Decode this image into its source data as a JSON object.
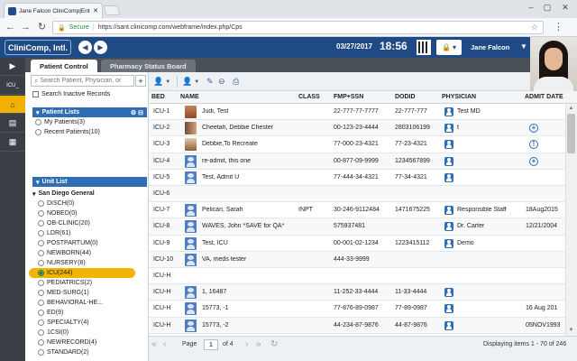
{
  "browser": {
    "tab_title": "Jane Falcon CliniComp|Ent",
    "secure_label": "Secure",
    "url": "https://sant.clinicomp.com/webframe/index.php/Cps"
  },
  "header": {
    "logo": "CliniComp, Intl.",
    "date": "03/27/2017",
    "time": "18:56",
    "user": "Jane Falcon"
  },
  "rail": {
    "icu_label": "ICU_"
  },
  "tabs": [
    "Patient Control",
    "Pharmacy Status Board"
  ],
  "left": {
    "search_placeholder": "Search Patient, Physician, or",
    "search_inactive": "Search Inactive Records",
    "patient_lists_header": "Patient Lists",
    "patient_lists": [
      "My Patients(3)",
      "Recent Patients(10)"
    ],
    "unit_list_header": "Unit List",
    "facility": "San Diego General",
    "units": [
      "DISCH(0)",
      "NOBED(0)",
      "OB-CLINIC(20)",
      "LDR(61)",
      "POSTPARTUM(0)",
      "NEWBORN(44)",
      "NURSERY(8)",
      "ICU(244)",
      "PEDIATRICS(2)",
      "MED-SURG(1)",
      "BEHAVIORAL-HE...",
      "ED(9)",
      "SPECIALTY(4)",
      "1CSI(0)",
      "NEWRECORD(4)",
      "STANDARD(2)"
    ],
    "selected_unit_index": 7
  },
  "grid": {
    "columns": [
      "BED",
      "NAME",
      "CLASS",
      "FMP+SSN",
      "DODID",
      "PHYSICIAN",
      "ADMIT DATE"
    ],
    "rows": [
      {
        "bed": "ICU-1",
        "pic": "photo",
        "name": "Judi, Test",
        "cls": "",
        "fmp": "22-777-77-7777",
        "dodid": "22-777-777",
        "phys_icon": true,
        "physician": "Test MD",
        "admit": "",
        "status": ""
      },
      {
        "bed": "ICU-2",
        "pic": "photo2",
        "name": "Cheetah, Debbie Chester",
        "cls": "",
        "fmp": "00-123-23-4444",
        "dodid": "2803106199",
        "phys_icon": true,
        "physician": "t",
        "admit": "",
        "status": "plus"
      },
      {
        "bed": "ICU-3",
        "pic": "photo3",
        "name": "Debbie,To Recreate",
        "cls": "",
        "fmp": "77-000-23-4321",
        "dodid": "77-23-4321",
        "phys_icon": true,
        "physician": "",
        "admit": "",
        "status": "alert"
      },
      {
        "bed": "ICU-4",
        "pic": "ph",
        "name": "re-admit, this one",
        "cls": "",
        "fmp": "00-877-09-9999",
        "dodid": "1234567899",
        "phys_icon": true,
        "physician": "",
        "admit": "",
        "status": "plus"
      },
      {
        "bed": "ICU-5",
        "pic": "ph",
        "name": "Test, Admit U",
        "cls": "",
        "fmp": "77-444-34-4321",
        "dodid": "77-34-4321",
        "phys_icon": true,
        "physician": "",
        "admit": "",
        "status": ""
      },
      {
        "bed": "ICU-6",
        "pic": "",
        "name": "",
        "cls": "",
        "fmp": "",
        "dodid": "",
        "phys_icon": false,
        "physician": "",
        "admit": "",
        "status": ""
      },
      {
        "bed": "ICU-7",
        "pic": "ph",
        "name": "Pelican, Sarah",
        "cls": "INPT",
        "fmp": "30-246-9112484",
        "dodid": "1471675225",
        "phys_icon": true,
        "physician": "Responsible Staff",
        "admit": "18Aug2015",
        "status": ""
      },
      {
        "bed": "ICU-8",
        "pic": "ph",
        "name": "WAVES, John *SAVE for QA*",
        "cls": "",
        "fmp": "575937481",
        "dodid": "",
        "phys_icon": true,
        "physician": "Dr. Carter",
        "admit": "12/21/2004",
        "status": ""
      },
      {
        "bed": "ICU-9",
        "pic": "ph",
        "name": "Test, ICU",
        "cls": "",
        "fmp": "00-001-02-1234",
        "dodid": "1223415112",
        "phys_icon": true,
        "physician": "Demo",
        "admit": "",
        "status": ""
      },
      {
        "bed": "ICU-10",
        "pic": "ph",
        "name": "VA, meds tester",
        "cls": "",
        "fmp": "444-33-9999",
        "dodid": "",
        "phys_icon": false,
        "physician": "",
        "admit": "",
        "status": ""
      },
      {
        "bed": "ICU-H",
        "pic": "",
        "name": "",
        "cls": "",
        "fmp": "",
        "dodid": "",
        "phys_icon": false,
        "physician": "",
        "admit": "",
        "status": ""
      },
      {
        "bed": "ICU-H",
        "pic": "ph",
        "name": "1, 16487",
        "cls": "",
        "fmp": "11-252-33-4444",
        "dodid": "11-33-4444",
        "phys_icon": true,
        "physician": "",
        "admit": "",
        "status": ""
      },
      {
        "bed": "ICU-H",
        "pic": "ph",
        "name": "15773, -1",
        "cls": "",
        "fmp": "77-876-89-0987",
        "dodid": "77-89-0987",
        "phys_icon": true,
        "physician": "",
        "admit": "16 Aug 201",
        "status": ""
      },
      {
        "bed": "ICU-H",
        "pic": "ph",
        "name": "15773, -2",
        "cls": "",
        "fmp": "44-234-87-9876",
        "dodid": "44-87-9876",
        "phys_icon": true,
        "physician": "",
        "admit": "05NOV1993",
        "status": ""
      }
    ]
  },
  "pager": {
    "page_label": "Page",
    "page": "1",
    "of": "of 4",
    "display": "Displaying items 1 - 70 of 246"
  }
}
